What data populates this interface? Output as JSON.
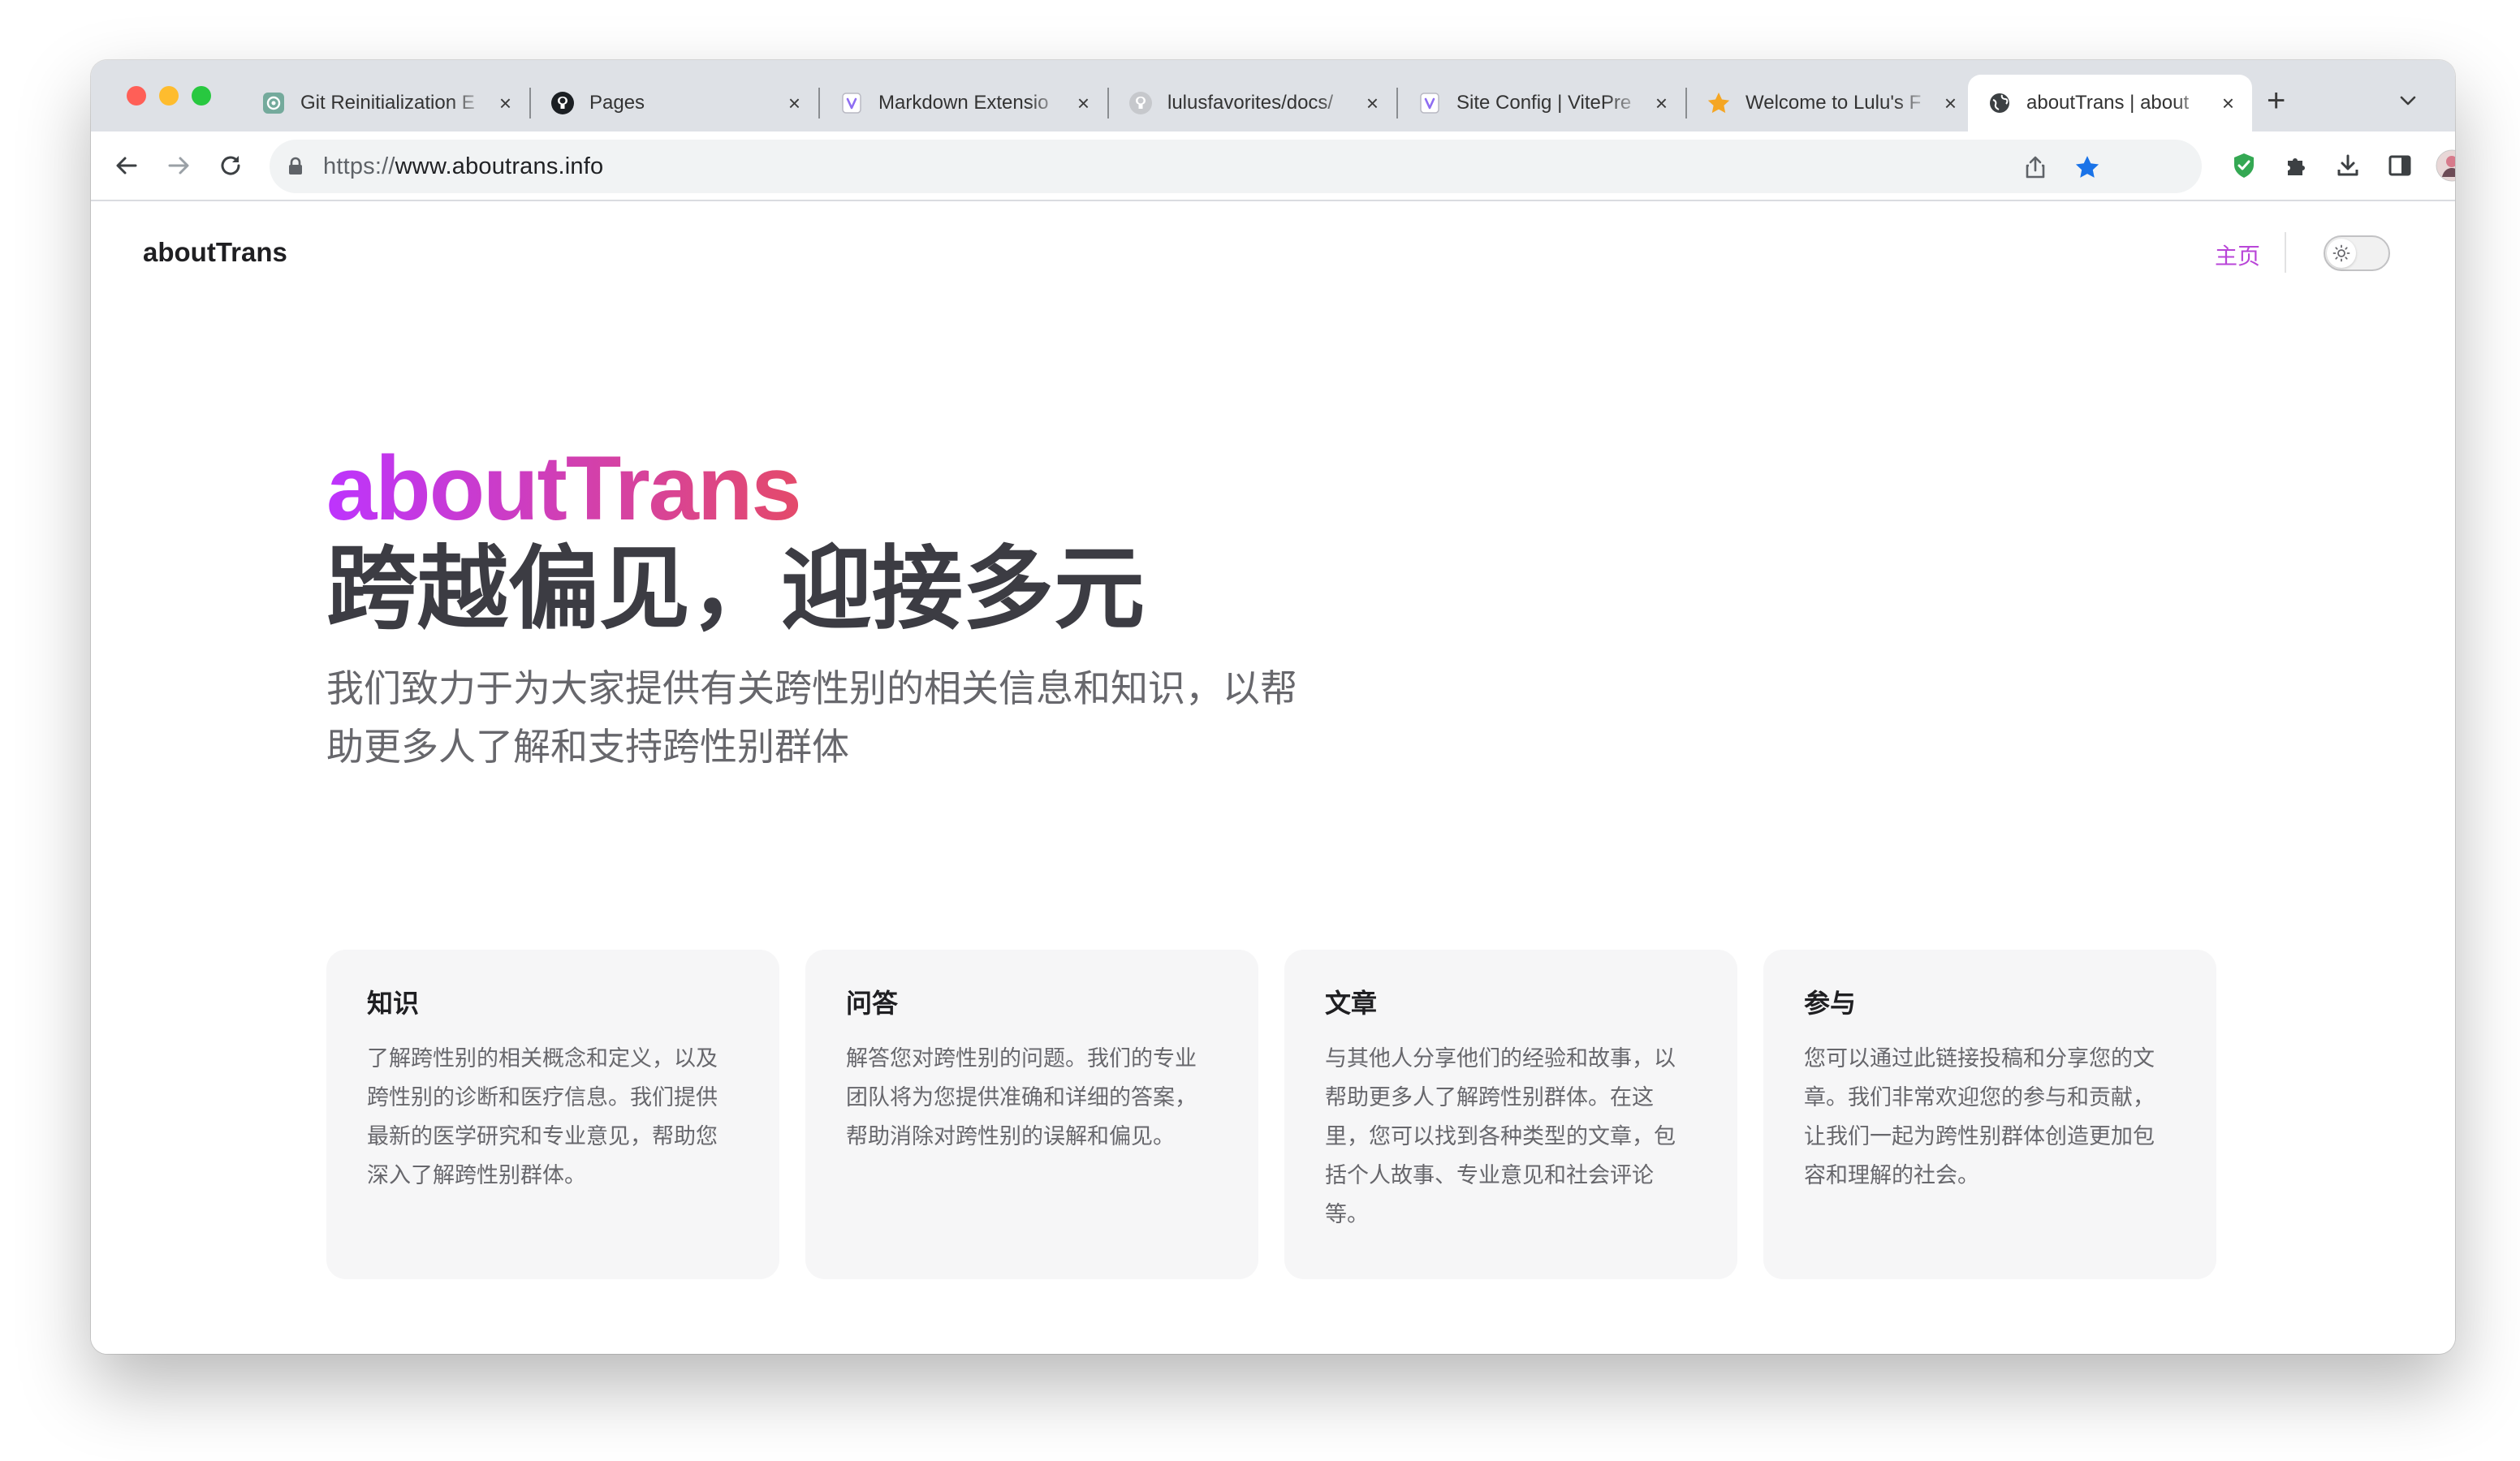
{
  "browser": {
    "tabs": [
      {
        "title": "Git Reinitialization E",
        "icon": "chatgpt-icon",
        "close": "×"
      },
      {
        "title": "Pages",
        "icon": "github-icon",
        "close": "×"
      },
      {
        "title": "Markdown Extensio",
        "icon": "vitepress-icon",
        "close": "×"
      },
      {
        "title": "lulusfavorites/docs/",
        "icon": "github-icon",
        "close": "×"
      },
      {
        "title": "Site Config | VitePre",
        "icon": "vitepress-icon",
        "close": "×"
      },
      {
        "title": "Welcome to Lulu's F",
        "icon": "star-icon",
        "close": "×"
      },
      {
        "title": "aboutTrans | about",
        "icon": "globe-icon",
        "close": "×",
        "active": true
      }
    ],
    "new_tab": "+",
    "url": {
      "scheme": "https://",
      "host": "www.aboutrans.info"
    }
  },
  "site": {
    "title": "aboutTrans",
    "nav": {
      "home": "主页"
    }
  },
  "hero": {
    "name": "aboutTrans",
    "text": "跨越偏见，迎接多元",
    "tagline": "我们致力于为大家提供有关跨性别的相关信息和知识，以帮助更多人了解和支持跨性别群体"
  },
  "features": [
    {
      "title": "知识",
      "details": "了解跨性别的相关概念和定义，以及跨性别的诊断和医疗信息。我们提供最新的医学研究和专业意见，帮助您深入了解跨性别群体。"
    },
    {
      "title": "问答",
      "details": "解答您对跨性别的问题。我们的专业团队将为您提供准确和详细的答案，帮助消除对跨性别的误解和偏见。"
    },
    {
      "title": "文章",
      "details": "与其他人分享他们的经验和故事，以帮助更多人了解跨性别群体。在这里，您可以找到各种类型的文章，包括个人故事、专业意见和社会评论等。"
    },
    {
      "title": "参与",
      "details": "您可以通过此链接投稿和分享您的文章。我们非常欢迎您的参与和贡献，让我们一起为跨性别群体创造更加包容和理解的社会。"
    }
  ],
  "colors": {
    "brand_gradient_start": "#bd34fe",
    "brand_gradient_end": "#e44a6a",
    "nav_link": "#b945d8"
  }
}
